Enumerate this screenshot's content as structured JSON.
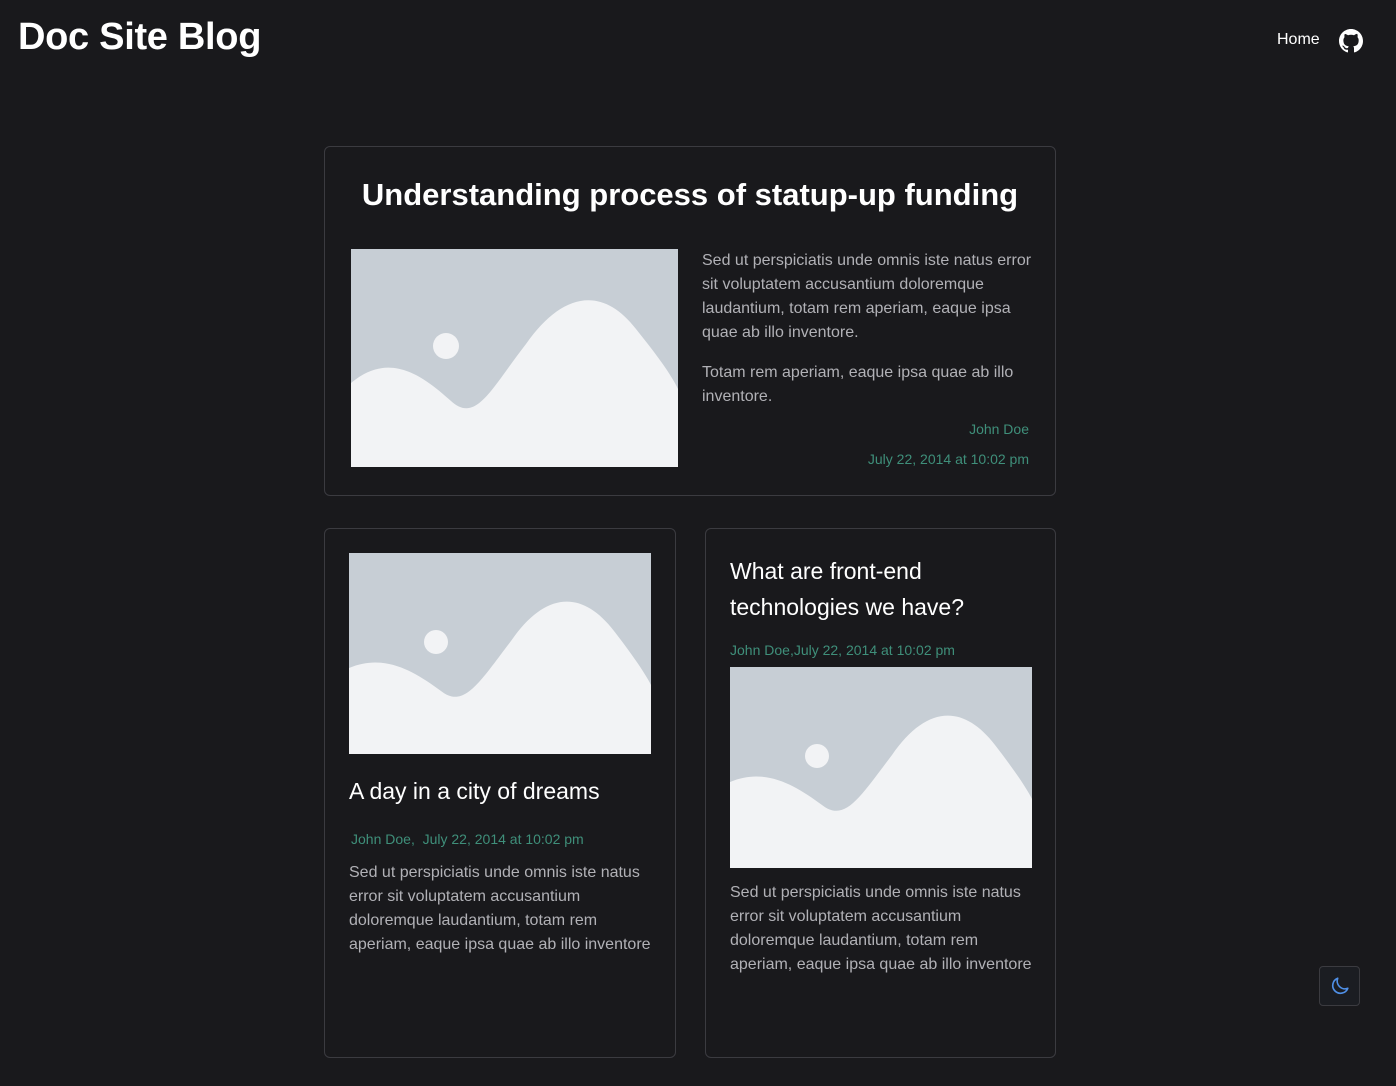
{
  "header": {
    "site_title": "Doc Site Blog",
    "nav": {
      "home_label": "Home",
      "github_icon": "github-icon"
    }
  },
  "featured_post": {
    "title": "Understanding process of statup-up funding",
    "image_icon": "image-placeholder-icon",
    "paragraph_1": "Sed ut perspiciatis unde omnis iste natus error sit voluptatem accusantium doloremque laudantium, totam rem aperiam, eaque ipsa quae ab illo inventore.",
    "paragraph_2": "Totam rem aperiam, eaque ipsa quae ab illo inventore.",
    "author": "John Doe",
    "date": "July 22, 2014 at 10:02 pm"
  },
  "posts": [
    {
      "title": "A day in a city of dreams",
      "author": "John Doe",
      "separator": ",",
      "date": "July 22, 2014 at 10:02 pm",
      "excerpt": "Sed ut perspiciatis unde omnis iste natus error sit voluptatem accusantium doloremque laudantium, totam rem aperiam, eaque ipsa quae ab illo inventore",
      "image_icon": "image-placeholder-icon"
    },
    {
      "title": "What are front-end technologies we have?",
      "author": "John Doe",
      "separator": ",",
      "date": "July 22, 2014 at 10:02 pm",
      "excerpt": "Sed ut perspiciatis unde omnis iste natus error sit voluptatem accusantium doloremque laudantium, totam rem aperiam, eaque ipsa quae ab illo inventore",
      "image_icon": "image-placeholder-icon"
    }
  ],
  "theme_toggle": {
    "icon": "moon-icon"
  },
  "colors": {
    "background": "#19191c",
    "card_border": "#3b3b40",
    "meta_text": "#3f8f7a",
    "body_text": "#b1b1b6",
    "placeholder_sky": "#c7ced5",
    "placeholder_fg": "#f2f3f5",
    "moon": "#4f8fe6"
  }
}
